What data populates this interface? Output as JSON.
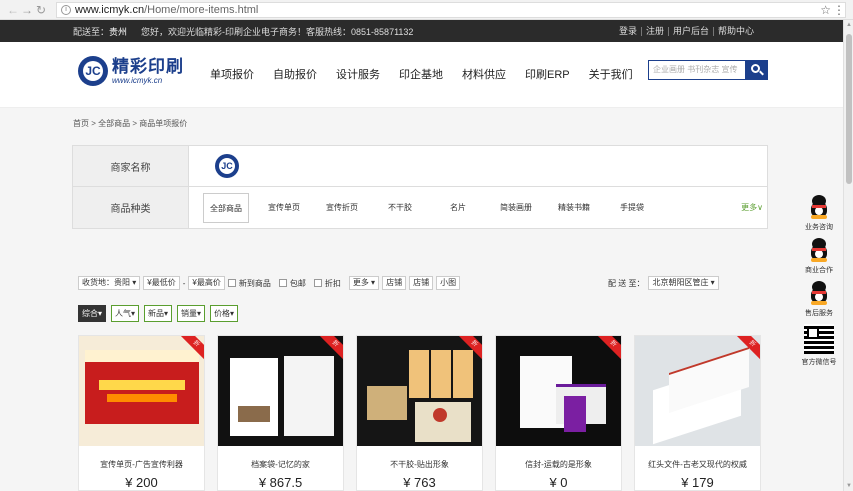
{
  "browser": {
    "url_host": "www.icmyk.cn",
    "url_path": "/Home/more-items.html",
    "back_glyph": "←",
    "forward_glyph": "→",
    "reload_glyph": "↻",
    "star_glyph": "☆",
    "menu_glyph": "⋮"
  },
  "topbar": {
    "ship_label": "配送至：",
    "ship_city": "贵州",
    "welcome": "您好，欢迎光临精彩-印刷企业电子商务！客服热线：0851-85871132",
    "links": [
      "登录",
      "注册",
      "用户后台",
      "帮助中心"
    ]
  },
  "header": {
    "logo_mark": "JC",
    "logo_cn": "精彩印刷",
    "logo_url": "www.icmyk.cn",
    "nav": [
      "单项报价",
      "自助报价",
      "设计服务",
      "印企基地",
      "材料供应",
      "印刷ERP",
      "关于我们"
    ],
    "search_placeholder": "企业画册 书刊杂志 宣传"
  },
  "breadcrumb": "首页 > 全部商品 > 商品单项报价",
  "filters": {
    "merchant_label": "商家名称",
    "merchant_logo": "JC",
    "category_label": "商品种类",
    "categories": [
      "全部商品",
      "宣传单页",
      "宣传折页",
      "不干胶",
      "名片",
      "简装画册",
      "精装书籍",
      "手提袋"
    ],
    "more": "更多∨"
  },
  "sortbar": {
    "origin_label": "收货地：",
    "origin_value": "贵阳",
    "price_min": "¥最低价",
    "price_max": "¥最高价",
    "dash": "-",
    "check_new": "新到商品",
    "check_ship": "包邮",
    "check_discount": "折扣",
    "more": "更多",
    "btn_shop1": "店铺",
    "btn_shop2": "店铺",
    "btn_small": "小图",
    "delivery_label": "配 送 至：",
    "delivery_value": "北京朝阳区管庄"
  },
  "tabs": [
    "综合▾",
    "人气▾",
    "新品▾",
    "销量▾",
    "价格▾"
  ],
  "products": [
    {
      "name": "宣传单页-广告宣传利器",
      "price": "¥ 200",
      "ribbon": "折"
    },
    {
      "name": "档案袋-记忆的家",
      "price": "¥ 867.5",
      "ribbon": "折"
    },
    {
      "name": "不干胶-贴出形象",
      "price": "¥ 763",
      "ribbon": "折"
    },
    {
      "name": "信封-运载的是形象",
      "price": "¥ 0",
      "ribbon": "折"
    },
    {
      "name": "红头文件-古老又现代的权威",
      "price": "¥ 179",
      "ribbon": "折"
    }
  ],
  "floatbar": [
    "业务咨询",
    "商业合作",
    "售后服务",
    "官方微信号"
  ],
  "colors": {
    "brand_blue": "#1c3f8c",
    "accent_green": "#5a9e2f",
    "ribbon_red": "#dd2222",
    "topbar_bg": "#2b2b2b"
  }
}
